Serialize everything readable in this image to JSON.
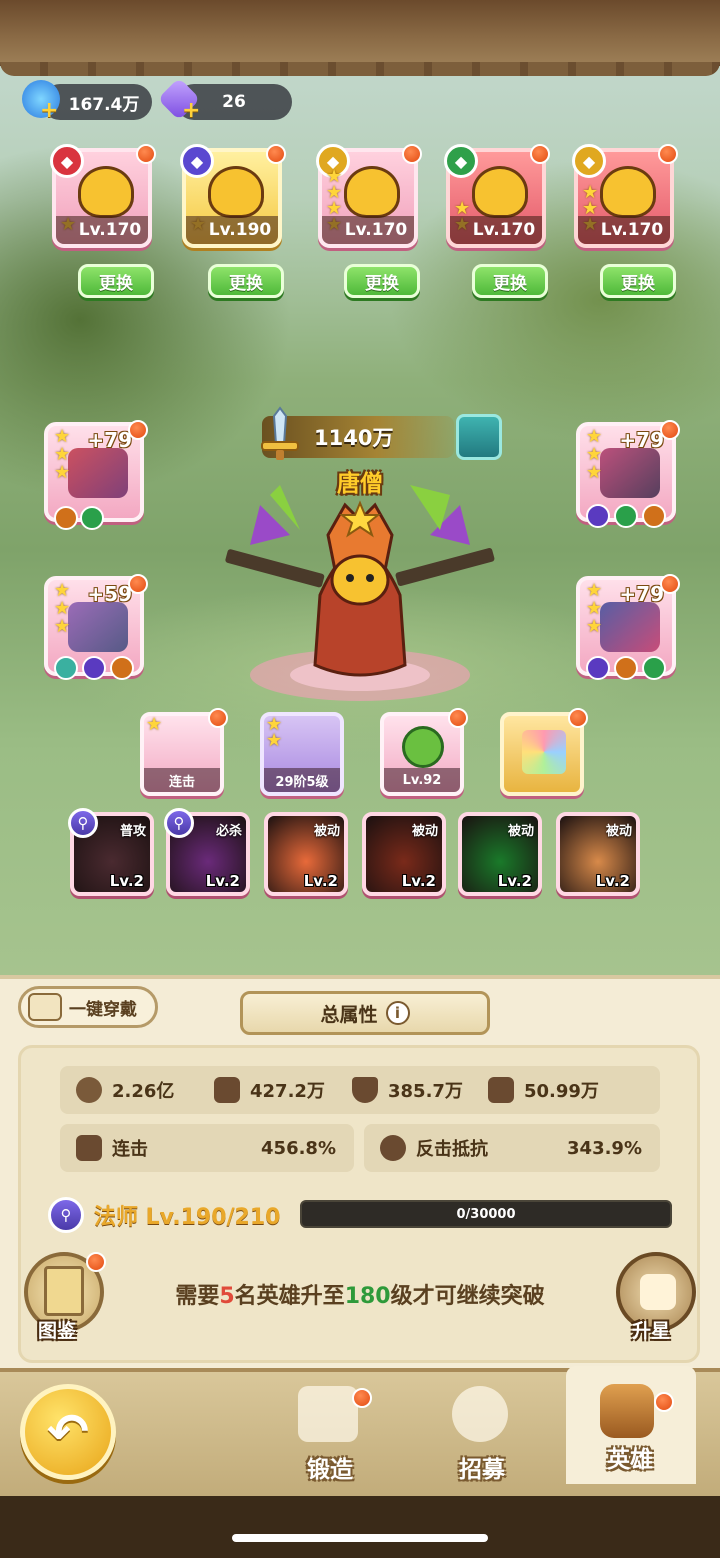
{
  "resources": {
    "energy": {
      "value": "167.4万",
      "icon": "blue-flame-icon"
    },
    "gems": {
      "value": "26",
      "icon": "purple-gem-icon"
    }
  },
  "team": [
    {
      "level": "Lv.170",
      "class_icon": "sword-icon",
      "badge_color": "#d9343f",
      "stars": 1
    },
    {
      "level": "Lv.190",
      "class_icon": "staff-icon",
      "badge_color": "#5a48d0",
      "stars": 1,
      "selected": true
    },
    {
      "level": "Lv.170",
      "class_icon": "shield-icon",
      "badge_color": "#e0a820",
      "stars": 4
    },
    {
      "level": "Lv.170",
      "class_icon": "book-icon",
      "badge_color": "#2fa04a",
      "stars": 2
    },
    {
      "level": "Lv.170",
      "class_icon": "shield-icon",
      "badge_color": "#e0a820",
      "stars": 3
    }
  ],
  "swap_label": "更换",
  "equipment": {
    "left_top": {
      "plus": "+79"
    },
    "left_bottom": {
      "plus": "+59"
    },
    "right_top": {
      "plus": "+79"
    },
    "right_bottom": {
      "plus": "+79"
    }
  },
  "power": {
    "value": "1140万"
  },
  "hero": {
    "name": "唐僧"
  },
  "extra_slots": {
    "combo_label": "连击",
    "wing_label": "29阶5级",
    "pet_level": "Lv.92"
  },
  "skills": [
    {
      "tag": "普攻",
      "level": "Lv.2",
      "color": "#4a2a30",
      "mage": true
    },
    {
      "tag": "必杀",
      "level": "Lv.2",
      "color": "#6a2a7a",
      "mage": true
    },
    {
      "tag": "被动",
      "level": "Lv.2",
      "color": "#e86a3a",
      "mage": false
    },
    {
      "tag": "被动",
      "level": "Lv.2",
      "color": "#7a2a1a",
      "mage": false
    },
    {
      "tag": "被动",
      "level": "Lv.2",
      "color": "#1a7a2a",
      "mage": false
    },
    {
      "tag": "被动",
      "level": "Lv.2",
      "color": "#d88a4a",
      "mage": false
    }
  ],
  "panel": {
    "one_key_label": "一键穿戴",
    "total_attr_label": "总属性",
    "stats": {
      "hp": "2.26亿",
      "attack": "427.2万",
      "defense": "385.7万",
      "speed": "50.99万",
      "combo_label": "连击",
      "combo_value": "456.8%",
      "counter_label": "反击抵抗",
      "counter_value": "343.9%"
    },
    "class_level": "法师 Lv.190/210",
    "xp": "0/30000",
    "xp_fraction": 0,
    "hint_prefix": "需要",
    "hint_count": "5",
    "hint_mid": "名英雄升至",
    "hint_level": "180",
    "hint_suffix": "级才可继续突破",
    "codex_label": "图鉴",
    "star_up_label": "升星"
  },
  "nav": {
    "forge": "锻造",
    "recruit": "招募",
    "hero": "英雄"
  }
}
